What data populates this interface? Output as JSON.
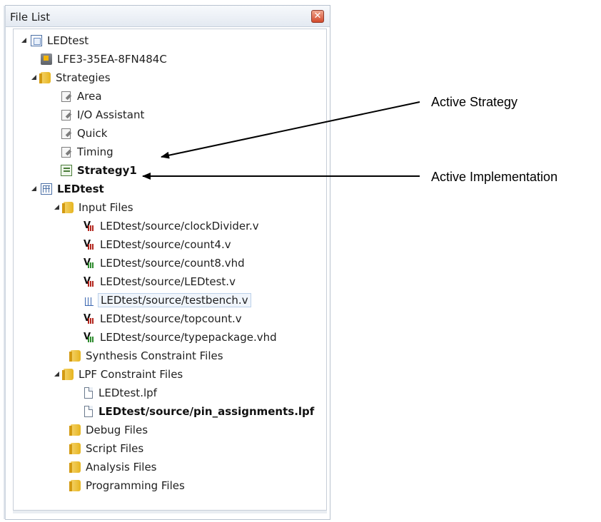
{
  "panel": {
    "title": "File List",
    "close_label": "✕"
  },
  "tree": [
    {
      "label": "LEDtest",
      "icon": "project-icon",
      "expanded": true
    },
    {
      "label": "LFE3-35EA-8FN484C",
      "icon": "device-icon"
    },
    {
      "label": "Strategies",
      "icon": "folder-icon",
      "expanded": true
    },
    {
      "label": "Area",
      "icon": "strategy-icon"
    },
    {
      "label": "I/O Assistant",
      "icon": "strategy-icon"
    },
    {
      "label": "Quick",
      "icon": "strategy-icon"
    },
    {
      "label": "Timing",
      "icon": "strategy-icon"
    },
    {
      "label": "Strategy1",
      "icon": "active-strategy-icon",
      "bold": true
    },
    {
      "label": "LEDtest",
      "icon": "implementation-icon",
      "bold": true,
      "expanded": true
    },
    {
      "label": "Input Files",
      "icon": "folder-icon",
      "expanded": true
    },
    {
      "label": "LEDtest/source/clockDivider.v",
      "icon": "verilog-file-icon"
    },
    {
      "label": "LEDtest/source/count4.v",
      "icon": "verilog-file-icon"
    },
    {
      "label": "LEDtest/source/count8.vhd",
      "icon": "vhdl-file-icon"
    },
    {
      "label": "LEDtest/source/LEDtest.v",
      "icon": "verilog-file-icon"
    },
    {
      "label": "LEDtest/source/testbench.v",
      "icon": "testbench-file-icon",
      "selected": true
    },
    {
      "label": "LEDtest/source/topcount.v",
      "icon": "verilog-file-icon"
    },
    {
      "label": "LEDtest/source/typepackage.vhd",
      "icon": "vhdl-file-icon"
    },
    {
      "label": "Synthesis Constraint Files",
      "icon": "folder-icon"
    },
    {
      "label": "LPF Constraint Files",
      "icon": "folder-icon",
      "expanded": true
    },
    {
      "label": "LEDtest.lpf",
      "icon": "lpf-file-icon"
    },
    {
      "label": "LEDtest/source/pin_assignments.lpf",
      "icon": "lpf-file-icon",
      "bold": true
    },
    {
      "label": "Debug Files",
      "icon": "folder-icon"
    },
    {
      "label": "Script Files",
      "icon": "folder-icon"
    },
    {
      "label": "Analysis Files",
      "icon": "folder-icon"
    },
    {
      "label": "Programming Files",
      "icon": "folder-icon"
    }
  ],
  "annotations": {
    "active_strategy": "Active Strategy",
    "active_implementation": "Active Implementation"
  }
}
